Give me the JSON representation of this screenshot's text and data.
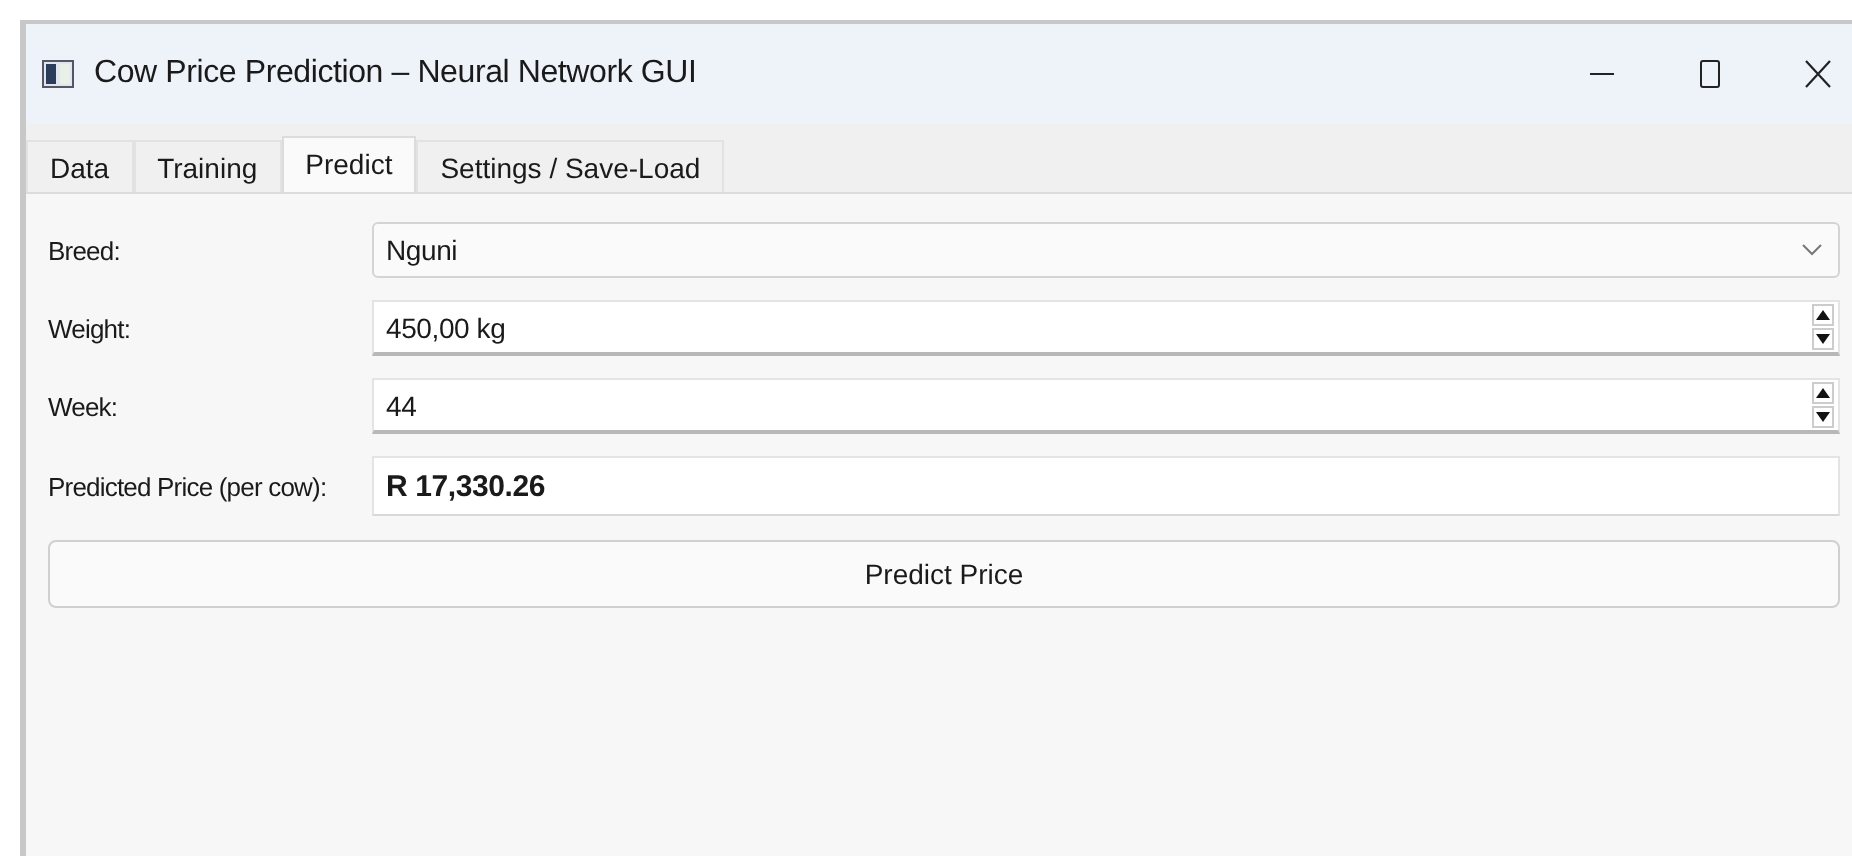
{
  "window": {
    "title": "Cow Price Prediction – Neural Network GUI"
  },
  "tabs": [
    {
      "label": "Data",
      "selected": false
    },
    {
      "label": "Training",
      "selected": false
    },
    {
      "label": "Predict",
      "selected": true
    },
    {
      "label": "Settings / Save-Load",
      "selected": false
    }
  ],
  "form": [
    {
      "kind": "combo",
      "label": "Breed:",
      "value": "Nguni"
    },
    {
      "kind": "spin",
      "label": "Weight:",
      "value": "450,00 kg"
    },
    {
      "kind": "spin",
      "label": "Week:",
      "value": "44"
    },
    {
      "kind": "output",
      "label": "Predicted Price (per cow):",
      "value": "R 17,330.26"
    }
  ],
  "button": "Predict Price"
}
